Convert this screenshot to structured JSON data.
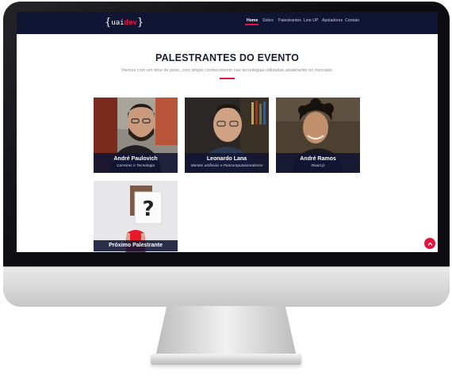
{
  "nav": {
    "logo": {
      "brace_open": "{",
      "text_white": "uai",
      "text_red": "dev",
      "brace_close": "}"
    },
    "links": [
      {
        "label": "Home"
      },
      {
        "label": "Sobre"
      },
      {
        "label": "Palestrantes"
      },
      {
        "label": "Line UP"
      },
      {
        "label": "Apoiadores"
      },
      {
        "label": "Contato"
      }
    ]
  },
  "section": {
    "title": "PALESTRANTES DO EVENTO",
    "subtitle": "Viemos com um time de peso, com amplo conhecimento nas tecnologias utilizadas atualmente no mercado."
  },
  "speakers": [
    {
      "name": "André Paulovich",
      "role": "Carreiras e Tecnologia"
    },
    {
      "name": "Leonardo Lana",
      "role": "Mentes artificiais e Pancomputacionalismo"
    },
    {
      "name": "André Ramos",
      "role": "React.js"
    },
    {
      "name": "Próximo Palestrante",
      "role": ""
    }
  ],
  "sign_glyph": "?",
  "colors": {
    "navbar": "#111534",
    "accent": "#e5133d",
    "title": "#1b1e33"
  }
}
